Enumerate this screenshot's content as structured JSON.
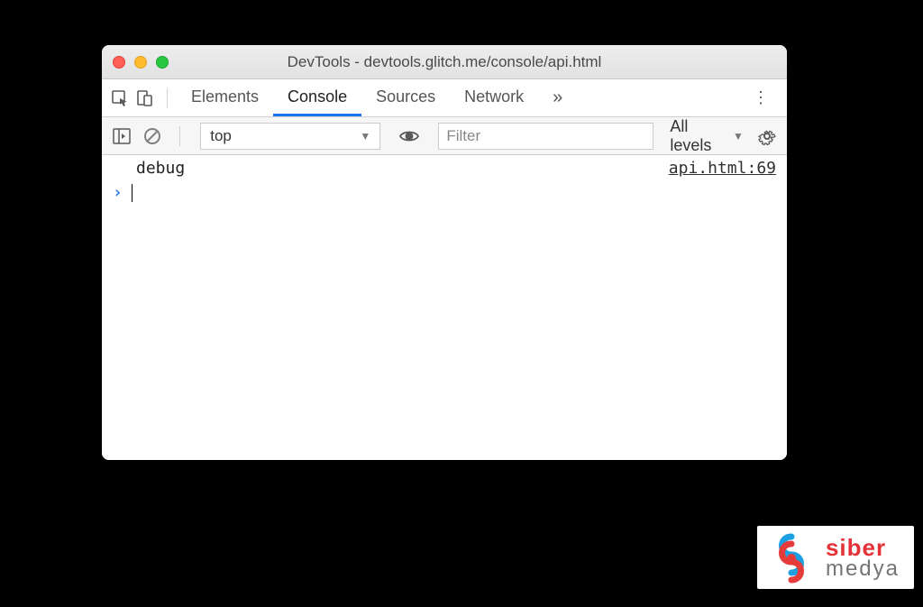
{
  "window": {
    "title": "DevTools - devtools.glitch.me/console/api.html"
  },
  "tabs": {
    "elements": "Elements",
    "console": "Console",
    "sources": "Sources",
    "network": "Network",
    "more": "»"
  },
  "toolbar": {
    "context": "top",
    "filter_placeholder": "Filter",
    "levels": "All levels"
  },
  "console": {
    "entries": [
      {
        "message": "debug",
        "source": "api.html:69"
      }
    ]
  },
  "watermark": {
    "line1": "siber",
    "line2": "medya"
  }
}
